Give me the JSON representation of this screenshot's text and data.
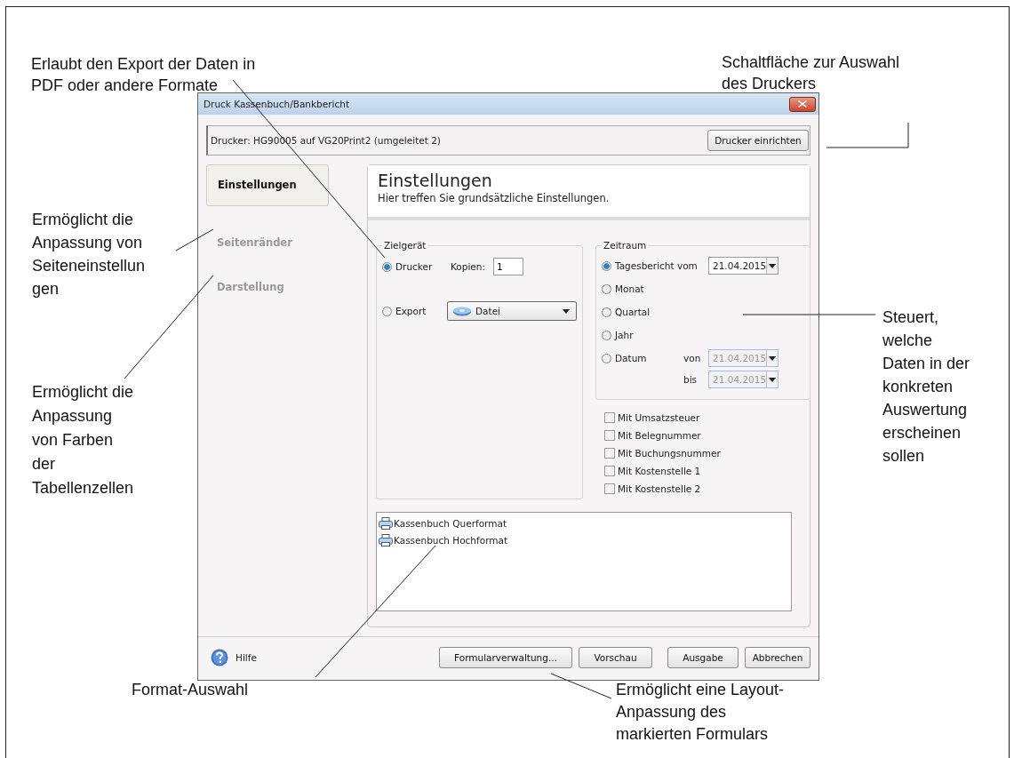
{
  "annotations": [
    {
      "lines": [
        "Erlaubt den Export der Daten in",
        "PDF oder andere Formate"
      ]
    },
    {
      "lines": [
        "Schaltfläche zur Auswahl",
        "des Druckers"
      ]
    },
    {
      "lines": [
        "Ermöglicht die",
        "Anpassung von",
        "Seiteneinstellun",
        "gen"
      ]
    },
    {
      "lines": [
        "Ermöglicht die",
        "Anpassung",
        "von Farben",
        "der",
        "Tabellenzellen"
      ]
    },
    {
      "lines": [
        "Steuert,",
        "welche",
        "Daten in der",
        "konkreten",
        "Auswertung",
        "erscheinen",
        "sollen"
      ]
    },
    {
      "lines": [
        "Format-Auswahl"
      ]
    },
    {
      "lines": [
        "Ermöglicht eine Layout-",
        "Anpassung des",
        "markierten Formulars"
      ]
    }
  ],
  "dialog": {
    "title": "Druck Kassenbuch/Bankbericht",
    "printer_label": "Drucker:  HG90005 auf VG20Print2 (umgeleitet 2)",
    "setup_button": "Drucker einrichten",
    "nav": [
      {
        "label": "Einstellungen",
        "selected": true
      },
      {
        "label": "Seitenränder",
        "selected": false
      },
      {
        "label": "Darstellung",
        "selected": false
      }
    ],
    "panel": {
      "title": "Einstellungen",
      "subtitle": "Hier treffen Sie grundsätzliche Einstellungen."
    },
    "target": {
      "legend": "Zielgerät",
      "options": [
        {
          "label": "Drucker",
          "selected": true
        },
        {
          "label": "Export",
          "selected": false
        }
      ],
      "copies_label": "Kopien:",
      "copies_value": "1",
      "export_select": "Datei"
    },
    "period": {
      "legend": "Zeitraum",
      "options": [
        {
          "label": "Tagesbericht vom",
          "selected": true
        },
        {
          "label": "Monat",
          "selected": false
        },
        {
          "label": "Quartal",
          "selected": false
        },
        {
          "label": "Jahr",
          "selected": false
        },
        {
          "label": "Datum",
          "selected": false
        }
      ],
      "day_date": {
        "value": "21.04.2015",
        "disabled": false
      },
      "from_label": "von",
      "from_date": {
        "value": "21.04.2015",
        "disabled": true
      },
      "to_label": "bis",
      "to_date": {
        "value": "21.04.2015",
        "disabled": true
      }
    },
    "checkboxes": [
      {
        "label": "Mit Umsatzsteuer",
        "checked": false
      },
      {
        "label": "Mit Belegnummer",
        "checked": false
      },
      {
        "label": "Mit Buchungsnummer",
        "checked": false
      },
      {
        "label": "Mit Kostenstelle 1",
        "checked": false
      },
      {
        "label": "Mit Kostenstelle 2",
        "checked": false
      }
    ],
    "formats": [
      {
        "label": "Kassenbuch Querformat"
      },
      {
        "label": "Kassenbuch Hochformat"
      }
    ],
    "help": "Hilfe",
    "buttons": [
      "Formularverwaltung...",
      "Vorschau",
      "Ausgabe",
      "Abbrechen"
    ]
  }
}
